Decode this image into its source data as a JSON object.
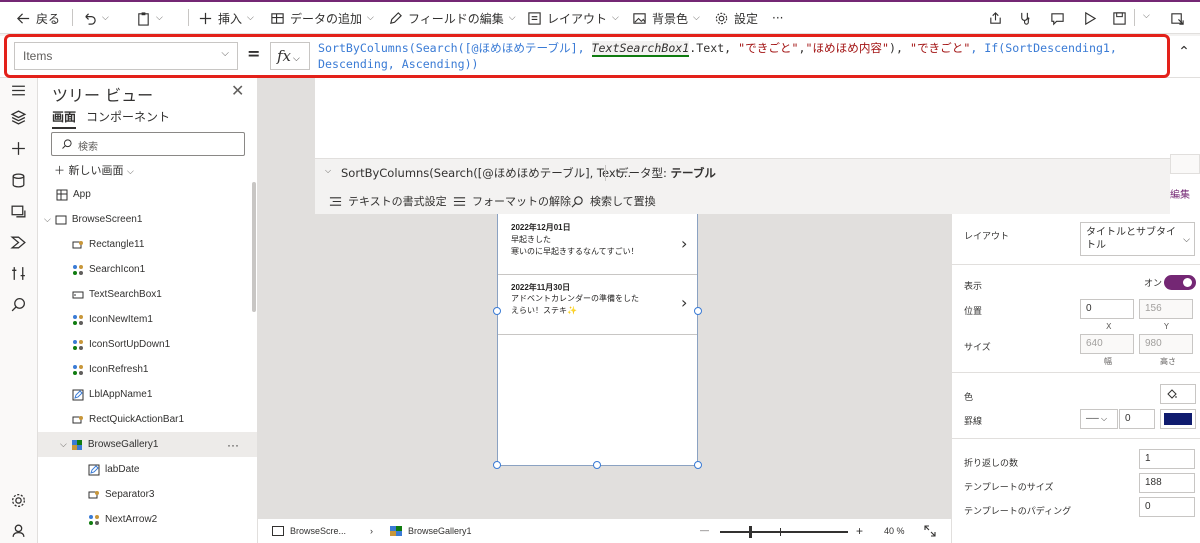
{
  "toolbar": {
    "back": "戻る",
    "insert": "挿入",
    "add_data": "データの追加",
    "edit_fields": "フィールドの編集",
    "layout": "レイアウト",
    "background": "背景色",
    "settings": "設定",
    "more": "···"
  },
  "formula_bar": {
    "property": "Items",
    "equals": "=",
    "fx": "fx",
    "formula_parts": {
      "p1": "SortByColumns(Search([@ほめほめテーブル], ",
      "p2": "TextSearchBox1",
      "p3": ".Text, ",
      "p4": "\"できごと\"",
      "p5": ",",
      "p6": "\"ほめほめ内容\"",
      "p7": "), ",
      "p8": "\"できごと\"",
      "p9": ", If(SortDescending1,",
      "p10": "Descending, Ascending))"
    },
    "summary": "SortByColumns(Search([@ほめほめテーブル], Text...",
    "data_type_label": "データ型:",
    "data_type_value": "テーブル",
    "tools": {
      "format_text": "テキストの書式設定",
      "remove_format": "フォーマットの解除",
      "find_replace": "検索して置換"
    }
  },
  "tree": {
    "title": "ツリー ビュー",
    "tab_screens": "画面",
    "tab_components": "コンポーネント",
    "search_placeholder": "検索",
    "new_screen": "新しい画面",
    "nodes": [
      {
        "label": "App"
      },
      {
        "label": "BrowseScreen1"
      },
      {
        "label": "Rectangle11"
      },
      {
        "label": "SearchIcon1"
      },
      {
        "label": "TextSearchBox1"
      },
      {
        "label": "IconNewItem1"
      },
      {
        "label": "IconSortUpDown1"
      },
      {
        "label": "IconRefresh1"
      },
      {
        "label": "LblAppName1"
      },
      {
        "label": "RectQuickActionBar1"
      },
      {
        "label": "BrowseGallery1"
      },
      {
        "label": "labDate"
      },
      {
        "label": "Separator3"
      },
      {
        "label": "NextArrow2"
      }
    ]
  },
  "gallery": {
    "items": [
      {
        "date": "2022年12月01日",
        "text": "早起きした\n寒いのに早起きするなんてすごい！"
      },
      {
        "date": "2022年11月30日",
        "text": "アドベントカレンダーの準備をした\nえらい！ステキ✨"
      }
    ]
  },
  "properties": {
    "edit_label": "編集",
    "layout_label": "レイアウト",
    "layout_value": "タイトルとサブタイトル",
    "visible_label": "表示",
    "visible_value": "オン",
    "position_label": "位置",
    "x": "0",
    "y": "156",
    "x_label": "X",
    "y_label": "Y",
    "size_label": "サイズ",
    "width": "640",
    "height": "980",
    "width_label": "幅",
    "height_label": "高さ",
    "color_label": "色",
    "border_label": "罫線",
    "border_width": "0",
    "border_color": "#0f1b6e",
    "wrap_label": "折り返しの数",
    "wrap_value": "1",
    "template_size_label": "テンプレートのサイズ",
    "template_size_value": "188",
    "template_padding_label": "テンプレートのパディング",
    "template_padding_value": "0"
  },
  "status": {
    "screen_crumb": "BrowseScre...",
    "gallery_crumb": "BrowseGallery1",
    "zoom_minus": "—",
    "zoom_plus": "+",
    "zoom_value": "40",
    "zoom_unit": "%",
    "zoom_fraction": 0.23
  },
  "colors": {
    "accent": "#742774",
    "highlight_box": "#e3211a",
    "toggle_on": "#742774"
  }
}
